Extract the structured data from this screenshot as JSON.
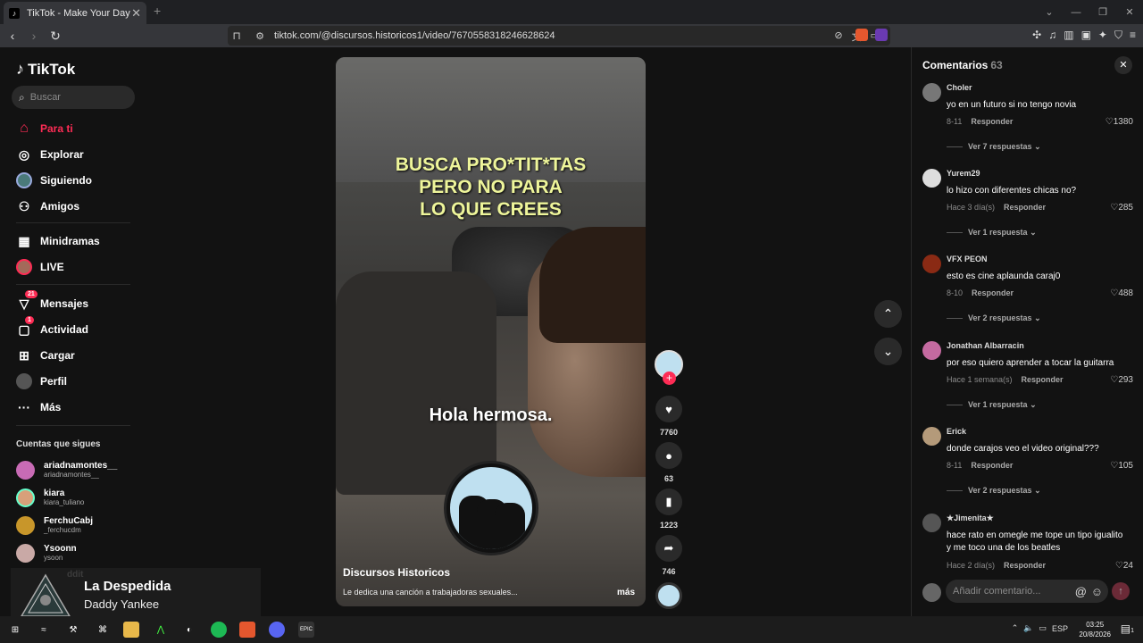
{
  "browser": {
    "tab_title": "TikTok - Make Your Day",
    "tab_close": "✕",
    "new_tab": "+",
    "url": "tiktok.com/@discursos.historicos1/video/7670558318246628624"
  },
  "sidebar": {
    "logo": "TikTok",
    "search_placeholder": "Buscar",
    "nav": [
      {
        "label": "Para ti",
        "icon": "home-icon",
        "glyph": "⌂",
        "active": true
      },
      {
        "label": "Explorar",
        "icon": "compass-icon",
        "glyph": "◎"
      },
      {
        "label": "Siguiendo",
        "icon": "following-avatar-icon",
        "glyph": ""
      },
      {
        "label": "Amigos",
        "icon": "friends-icon",
        "glyph": "⚇"
      },
      {
        "label": "Minidramas",
        "icon": "film-icon",
        "glyph": "▦"
      },
      {
        "label": "LIVE",
        "icon": "live-avatar-icon",
        "glyph": ""
      },
      {
        "label": "Mensajes",
        "icon": "messages-icon",
        "glyph": "▽",
        "badge": "21"
      },
      {
        "label": "Actividad",
        "icon": "activity-icon",
        "glyph": "▢",
        "badge": "1"
      },
      {
        "label": "Cargar",
        "icon": "upload-icon",
        "glyph": "⊞"
      },
      {
        "label": "Perfil",
        "icon": "profile-avatar-icon",
        "glyph": ""
      },
      {
        "label": "Más",
        "icon": "more-icon",
        "glyph": "···"
      }
    ],
    "following_title": "Cuentas que sigues",
    "following": [
      {
        "name": "ariadnamontes__",
        "handle": "ariadnamontes__",
        "color": "#c86bb5"
      },
      {
        "name": "kiara",
        "handle": "kiara_tuliano",
        "color": "#d8a07a"
      },
      {
        "name": "FerchuCabj",
        "handle": "_ferchucdm",
        "color": "#c8962a"
      },
      {
        "name": "Ysoonn",
        "handle": "ysoon",
        "color": "#c9a9a6"
      }
    ],
    "partial_item": "ddit"
  },
  "music": {
    "title": "La Despedida",
    "artist": "Daddy Yankee"
  },
  "video": {
    "caption": "BUSCA PRO*TIT*TAS\nPERO NO PARA\nLO QUE CREES",
    "subtitle": "Hola hermosa.",
    "author": "Discursos Historicos",
    "description": "Le dedica una canción a trabajadoras sexuales...",
    "more": "más"
  },
  "actions": {
    "likes": "7760",
    "comments": "63",
    "saves": "1223",
    "shares": "746"
  },
  "comments": {
    "title": "Comentarios",
    "count": "63",
    "items": [
      {
        "user": "Choler",
        "text": "yo en un futuro si no tengo novia",
        "date": "8-11",
        "reply": "Responder",
        "likes": "1380",
        "more": "Ver 7 respuestas",
        "color": "#777"
      },
      {
        "user": "Yurem29",
        "text": "lo hizo con diferentes chicas no?",
        "date": "Hace 3 día(s)",
        "reply": "Responder",
        "likes": "285",
        "more": "Ver 1 respuesta",
        "color": "#ddd"
      },
      {
        "user": "VFX PEON",
        "text": "esto es cine aplaunda caraj0",
        "date": "8-10",
        "reply": "Responder",
        "likes": "488",
        "more": "Ver 2 respuestas",
        "color": "#8a2a14"
      },
      {
        "user": "Jonathan Albarracin",
        "text": "por eso quiero aprender a tocar la guitarra",
        "date": "Hace 1 semana(s)",
        "reply": "Responder",
        "likes": "293",
        "more": "Ver 1 respuesta",
        "color": "#c46aa0"
      },
      {
        "user": "Erick",
        "text": "donde carajos veo el video original???",
        "date": "8-11",
        "reply": "Responder",
        "likes": "105",
        "more": "Ver 2 respuestas",
        "color": "#b49a7a"
      },
      {
        "user": "★Jimenita★",
        "text": "hace rato en omegle me tope un tipo igualito y me toco una de los beatles",
        "date": "Hace 2 día(s)",
        "reply": "Responder",
        "likes": "24",
        "more": "",
        "color": "#555"
      }
    ],
    "input_placeholder": "Añadir comentario...",
    "at": "@",
    "emoji": "☺",
    "send": "↑"
  },
  "taskbar": {
    "lang": "ESP",
    "time": "03:25",
    "date": "20/8/2026",
    "notifications": "1"
  }
}
